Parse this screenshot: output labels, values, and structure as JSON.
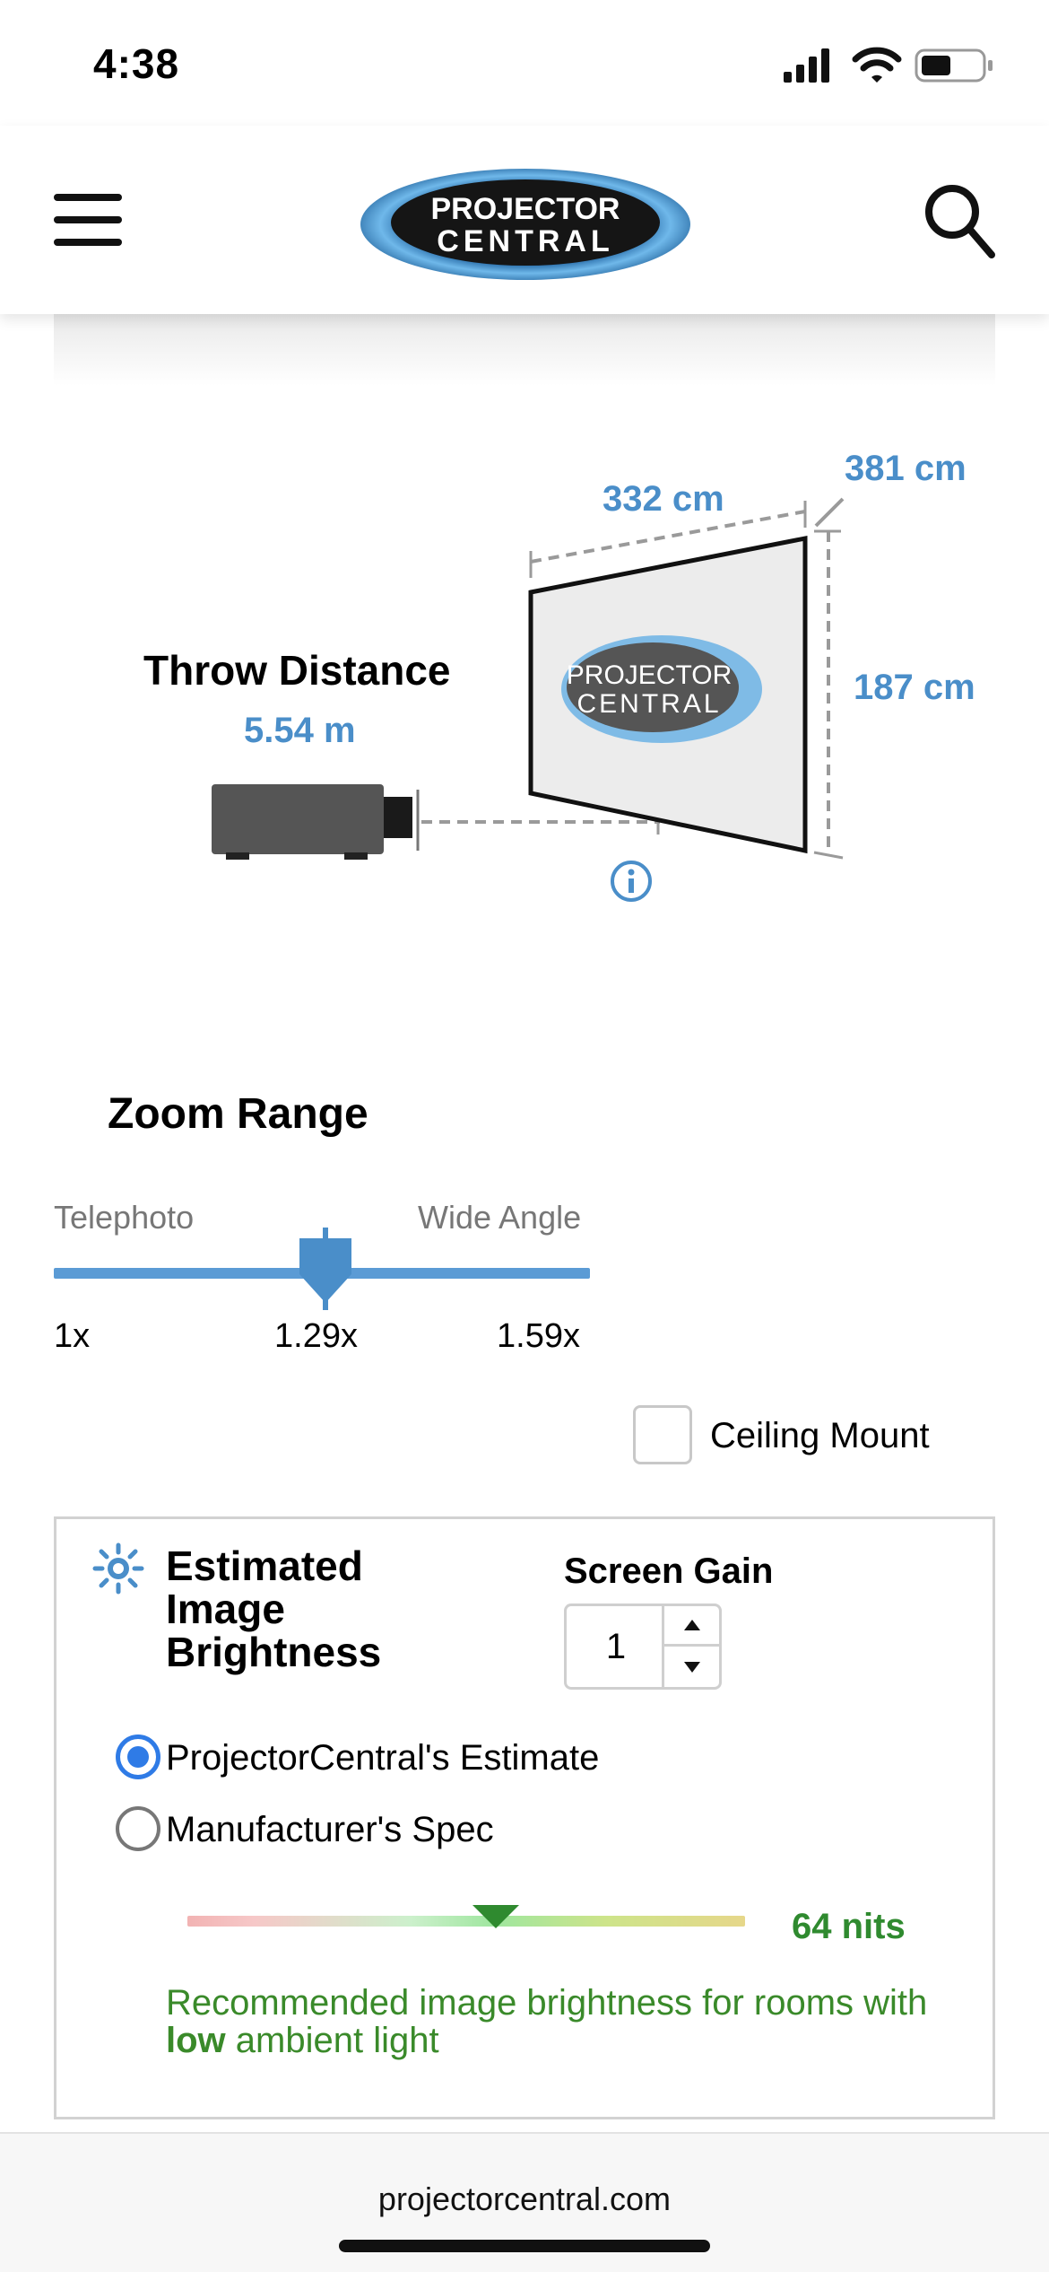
{
  "status_bar": {
    "time": "4:38"
  },
  "header": {
    "logo_line1": "PROJECTOR",
    "logo_line2": "CENTRAL"
  },
  "diagram": {
    "title": "Throw Distance",
    "throw_distance": "5.54 m",
    "screen_width": "332 cm",
    "screen_diagonal": "381 cm",
    "screen_height": "187 cm",
    "screen_logo_line1": "PROJECTOR",
    "screen_logo_line2": "CENTRAL"
  },
  "zoom": {
    "title": "Zoom Range",
    "left_label": "Telephoto",
    "right_label": "Wide Angle",
    "min": "1x",
    "current": "1.29x",
    "max": "1.59x",
    "position_fraction": 0.51
  },
  "ceiling_mount": {
    "label": "Ceiling Mount",
    "checked": false
  },
  "brightness": {
    "title": "Estimated Image Brightness",
    "screen_gain_label": "Screen Gain",
    "screen_gain_value": "1",
    "options": [
      {
        "label": "ProjectorCentral's Estimate",
        "selected": true
      },
      {
        "label": "Manufacturer's Spec",
        "selected": false
      }
    ],
    "value": "64 nits",
    "recommend_prefix": "Recommended image brightness for rooms with",
    "recommend_bold": "low",
    "recommend_suffix": "ambient light"
  },
  "footer": {
    "url": "projectorcentral.com"
  },
  "colors": {
    "accent_blue": "#4a8ec9",
    "radio_blue": "#2f7be6",
    "green": "#2f8a2f"
  }
}
